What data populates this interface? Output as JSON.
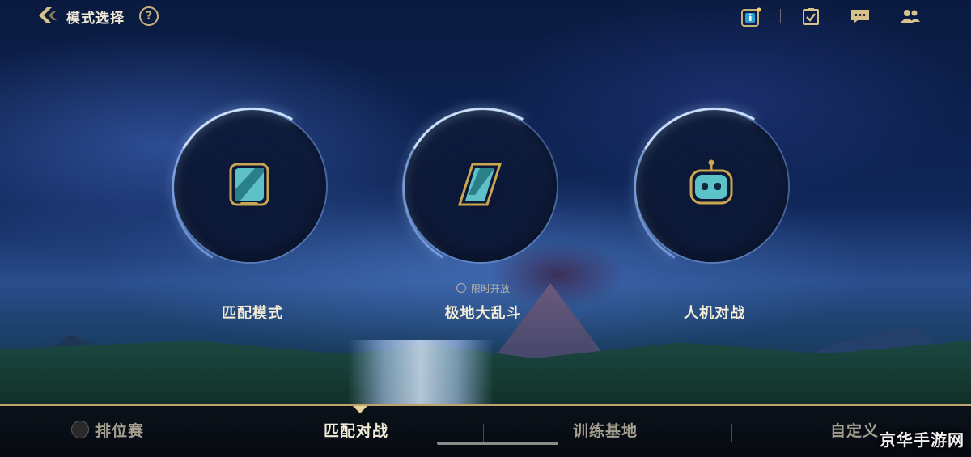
{
  "header": {
    "title": "模式选择",
    "help_symbol": "?"
  },
  "modes": [
    {
      "label": "匹配模式",
      "icon": "tablet-icon"
    },
    {
      "label": "极地大乱斗",
      "icon": "parallelogram-icon",
      "note": "限时开放"
    },
    {
      "label": "人机对战",
      "icon": "robot-icon"
    }
  ],
  "tabs": [
    {
      "label": "排位赛",
      "locked": true
    },
    {
      "label": "匹配对战",
      "active": true
    },
    {
      "label": "训练基地"
    },
    {
      "label": "自定义"
    }
  ],
  "watermark": "京华手游网",
  "colors": {
    "gold": "#c9b27a",
    "teal": "#7fd6d9"
  }
}
